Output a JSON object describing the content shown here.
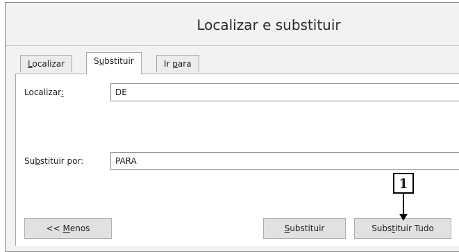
{
  "window": {
    "title": "Localizar e substituir"
  },
  "tabs": [
    {
      "pre": "",
      "ul": "L",
      "post": "ocalizar"
    },
    {
      "pre": "S",
      "ul": "u",
      "post": "bstituir"
    },
    {
      "pre": "Ir ",
      "ul": "p",
      "post": "ara"
    }
  ],
  "find": {
    "label_pre": "Localizar",
    "label_ul": ":",
    "value": "DE"
  },
  "replace": {
    "label_pre": "Su",
    "label_ul": "b",
    "label_post": "stituir por:",
    "value": "PARA"
  },
  "buttons": {
    "less": {
      "pre": "<< ",
      "ul": "M",
      "post": "enos"
    },
    "replace": {
      "pre": "",
      "ul": "S",
      "post": "ubstituir"
    },
    "replace_all": {
      "pre": "Subs",
      "ul": "t",
      "post": "ituir Tudo"
    }
  },
  "annotation": {
    "number": "1"
  }
}
